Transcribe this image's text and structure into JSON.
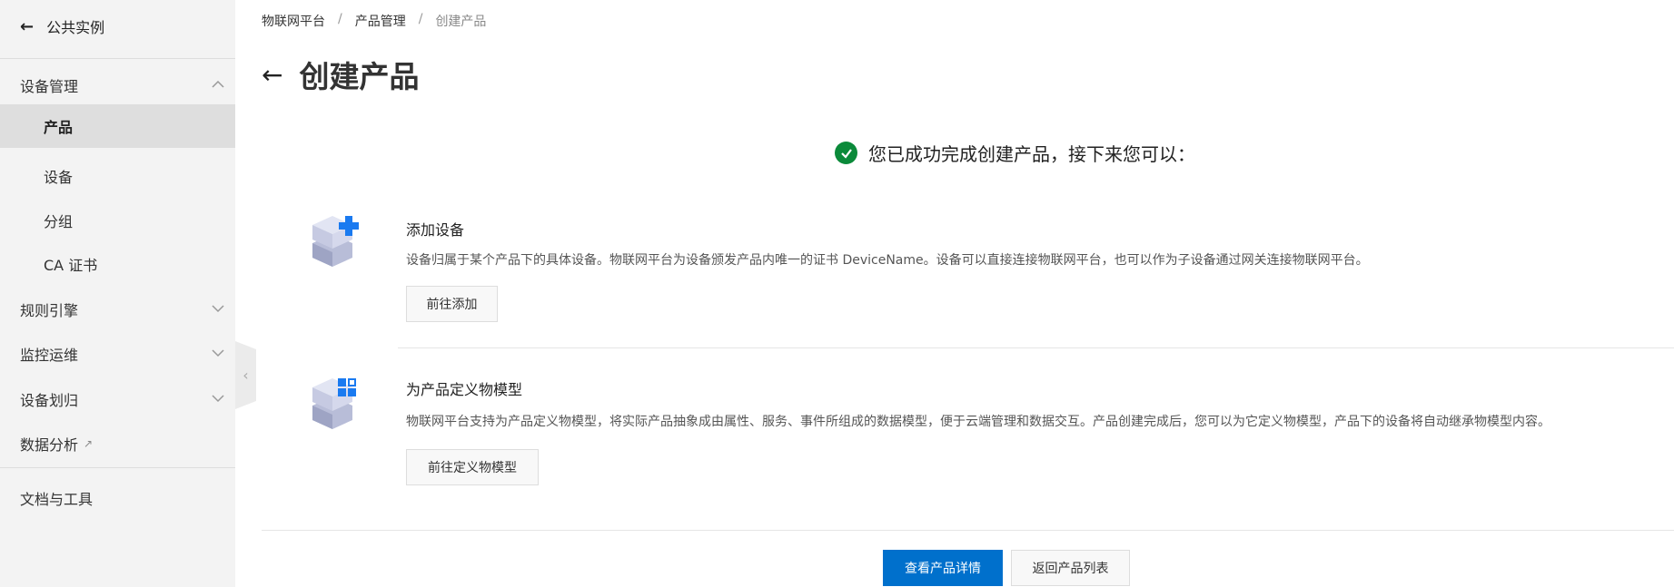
{
  "sidebar": {
    "back_label": "公共实例",
    "items": [
      {
        "label": "设备管理"
      },
      {
        "label": "产品"
      },
      {
        "label": "设备"
      },
      {
        "label": "分组"
      },
      {
        "label": "CA 证书"
      },
      {
        "label": "规则引擎"
      },
      {
        "label": "监控运维"
      },
      {
        "label": "设备划归"
      },
      {
        "label": "数据分析"
      },
      {
        "label": "文档与工具"
      }
    ]
  },
  "breadcrumb": [
    "物联网平台",
    "产品管理",
    "创建产品"
  ],
  "breadcrumb_sep": "/",
  "page_title": "创建产品",
  "success_message": "您已成功完成创建产品，接下来您可以：",
  "sections": [
    {
      "title": "添加设备",
      "description": "设备归属于某个产品下的具体设备。物联网平台为设备颁发产品内唯一的证书 DeviceName。设备可以直接连接物联网平台，也可以作为子设备通过网关连接物联网平台。",
      "button": "前往添加"
    },
    {
      "title": "为产品定义物模型",
      "description": "物联网平台支持为产品定义物模型，将实际产品抽象成由属性、服务、事件所组成的数据模型，便于云端管理和数据交互。产品创建完成后，您可以为它定义物模型，产品下的设备将自动继承物模型内容。",
      "button": "前往定义物模型"
    }
  ],
  "footer": {
    "primary": "查看产品详情",
    "secondary": "返回产品列表"
  },
  "colors": {
    "primary": "#0070cc",
    "success": "#0b8a3a"
  }
}
